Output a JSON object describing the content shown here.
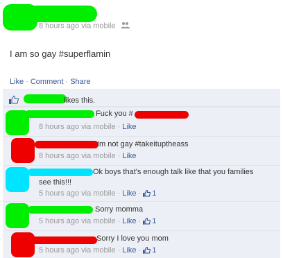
{
  "post": {
    "meta_time": "8 hours ago via mobile",
    "status_text": "I am so gay #superflamin",
    "actions": [
      "Like",
      "Comment",
      "Share"
    ]
  },
  "likes": {
    "text": "likes this."
  },
  "comments": [
    {
      "text": "Fuck you #",
      "meta": "8 hours ago via mobile",
      "like_label": "Like",
      "likes": "",
      "scribble": "#00ee00"
    },
    {
      "text": "Im not gay #takeituptheass",
      "meta": "8 hours ago via mobile",
      "like_label": "Like",
      "likes": "",
      "scribble": "#ee0000"
    },
    {
      "text": "Ok boys that's enough talk like that you families",
      "text2": "see this!!!",
      "meta": "5 hours ago via mobile",
      "like_label": "Like",
      "likes": "1",
      "scribble": "#00e5ff"
    },
    {
      "text": "Sorry momma",
      "meta": "5 hours ago via mobile",
      "like_label": "Like",
      "likes": "1",
      "scribble": "#00ee00"
    },
    {
      "text": "Sorry I love you mom",
      "meta": "5 hours ago via mobile",
      "like_label": "Like",
      "likes": "1",
      "scribble": "#ee0000"
    }
  ],
  "colors": {
    "link": "#3b5998",
    "meta": "#999999",
    "feedback_bg": "#eceff5"
  }
}
